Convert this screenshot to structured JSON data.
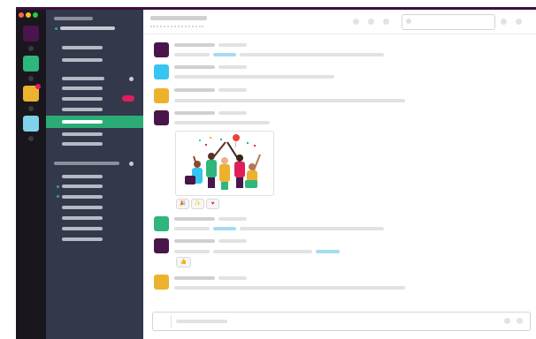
{
  "colors": {
    "titlebar": "#3f0e40",
    "rail": "#19171d",
    "sidebar": "#33394a",
    "active_channel": "#2bac76",
    "workspace_1": "#4a154b",
    "workspace_2": "#2eb67d",
    "workspace_3": "#ecb22e",
    "workspace_4": "#7fd2ea",
    "window_close": "#ff5f57",
    "window_min": "#febc2e",
    "window_max": "#28c840",
    "notification_badge": "#e01e5a",
    "message_avatar_purple": "#4a154b",
    "message_avatar_blue": "#36c5f0",
    "message_avatar_yellow": "#ecb22e",
    "message_avatar_green": "#2eb67d",
    "link_highlight": "#a6dcef"
  },
  "icons": {
    "search": "search-icon",
    "reaction_1": "party-popper-icon",
    "reaction_2": "sparkles-icon",
    "reaction_3": "heart-icon",
    "reaction_4": "thumbs-up-icon",
    "illustration": "high-five-team-illustration"
  },
  "reactions": {
    "first": [
      "🎉",
      "✨",
      "♥"
    ],
    "second": [
      "👍"
    ]
  }
}
